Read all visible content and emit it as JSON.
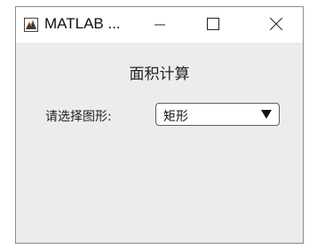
{
  "window": {
    "title": "MATLAB ...",
    "icon": "matlab-figure-icon",
    "controls": [
      "minimize-icon",
      "maximize-icon",
      "close-icon"
    ]
  },
  "main": {
    "heading": "面积计算",
    "shape_label": "请选择图形:",
    "shape_select": {
      "selected": "矩形"
    }
  },
  "colors": {
    "background": "#ececec",
    "titlebar": "#ffffff",
    "text": "#222222"
  }
}
